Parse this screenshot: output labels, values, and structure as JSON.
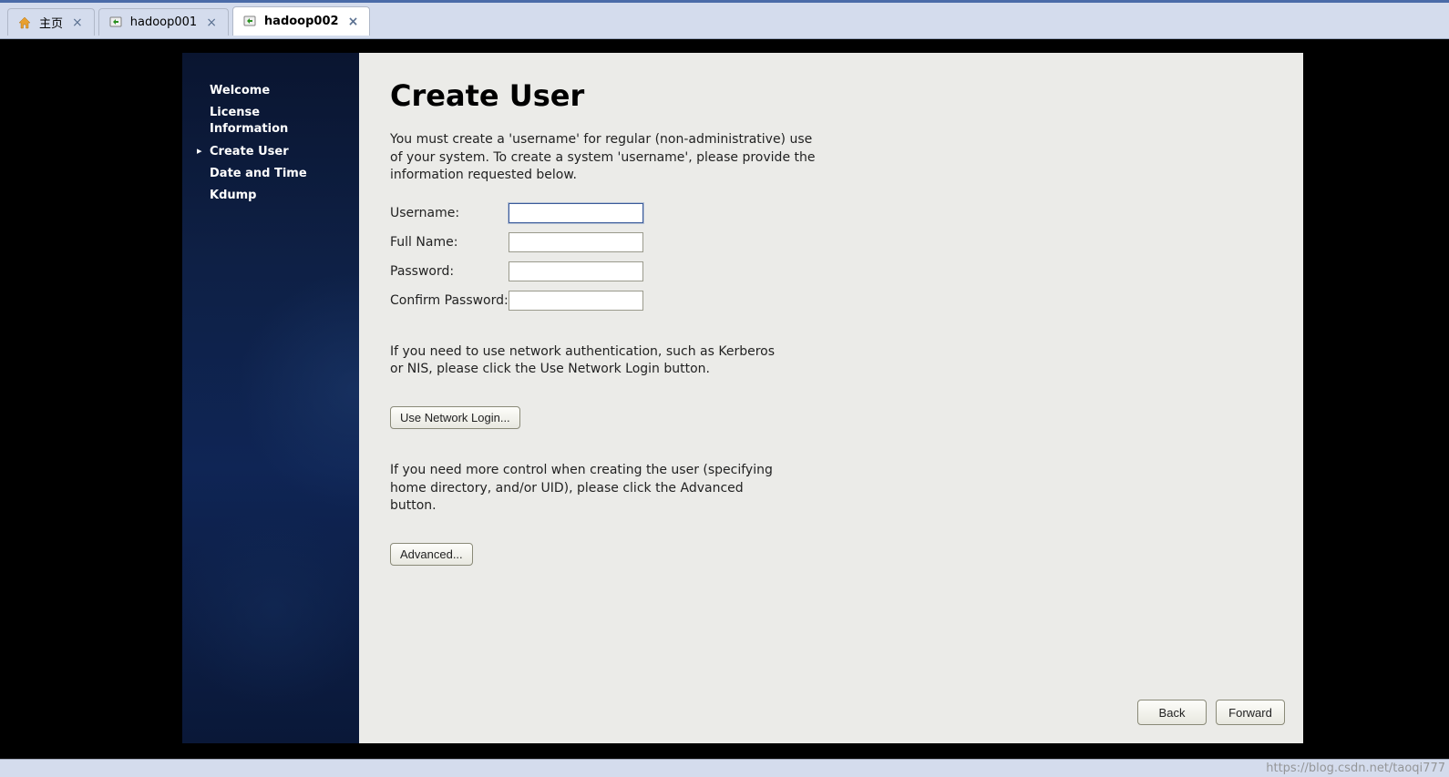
{
  "tabs": [
    {
      "label": "主页",
      "icon": "home",
      "active": false
    },
    {
      "label": "hadoop001",
      "icon": "vm",
      "active": false
    },
    {
      "label": "hadoop002",
      "icon": "vm",
      "active": true
    }
  ],
  "sidebar": {
    "items": [
      {
        "label": "Welcome",
        "active": false
      },
      {
        "label": "License Information",
        "active": false
      },
      {
        "label": "Create User",
        "active": true
      },
      {
        "label": "Date and Time",
        "active": false
      },
      {
        "label": "Kdump",
        "active": false
      }
    ]
  },
  "main": {
    "title": "Create User",
    "intro": "You must create a 'username' for regular (non-administrative) use of your system.  To create a system 'username', please provide the information requested below.",
    "form": {
      "username_label": "Username:",
      "username_value": "",
      "fullname_label": "Full Name:",
      "fullname_value": "",
      "password_label": "Password:",
      "password_value": "",
      "confirm_label": "Confirm Password:",
      "confirm_value": ""
    },
    "network_text": "If you need to use network authentication, such as Kerberos or NIS, please click the Use Network Login button.",
    "network_button": "Use Network Login...",
    "advanced_text": "If you need more control when creating the user (specifying home directory, and/or UID), please click the Advanced button.",
    "advanced_button": "Advanced...",
    "nav": {
      "back": "Back",
      "forward": "Forward"
    }
  },
  "watermark": "https://blog.csdn.net/taoqi777"
}
